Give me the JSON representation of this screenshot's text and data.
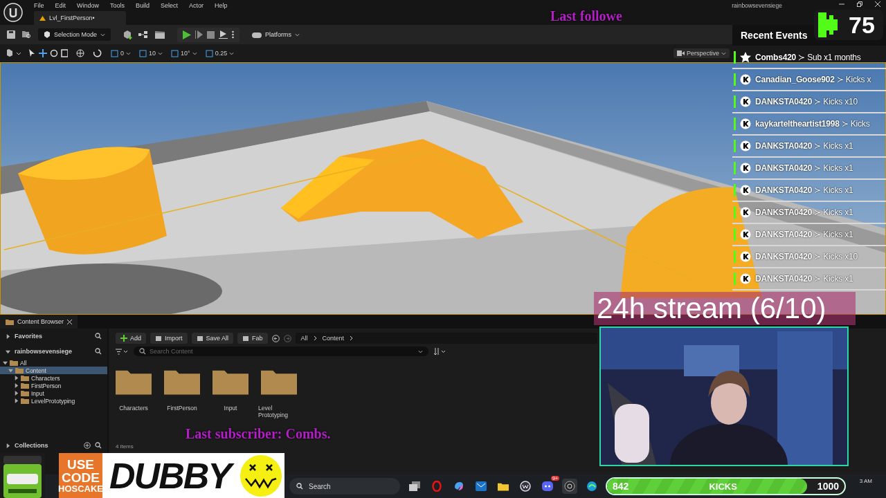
{
  "menu": [
    "File",
    "Edit",
    "Window",
    "Tools",
    "Build",
    "Select",
    "Actor",
    "Help"
  ],
  "account": "rainbowsevensiege",
  "level_tab": "Lvl_FirstPerson•",
  "toolbar": {
    "mode": "Selection Mode",
    "platforms": "Platforms"
  },
  "viewport_toolbar": {
    "snaps": [
      "0",
      "10",
      "10°",
      "0.25"
    ],
    "view": "Perspective"
  },
  "content_browser": {
    "tab": "Content Browser",
    "sections": [
      {
        "label": "Favorites",
        "expanded": false
      },
      {
        "label": "rainbowsevensiege",
        "expanded": true
      }
    ],
    "tree": [
      {
        "label": "All",
        "selected": false,
        "expanded": true,
        "children": [
          {
            "label": "Content",
            "selected": true,
            "expanded": true,
            "children": [
              {
                "label": "Characters",
                "selected": false,
                "expanded": false
              },
              {
                "label": "FirstPerson",
                "selected": false,
                "expanded": false
              },
              {
                "label": "Input",
                "selected": false,
                "expanded": false
              },
              {
                "label": "LevelPrototyping",
                "selected": false,
                "expanded": false
              }
            ]
          }
        ]
      }
    ],
    "collections": {
      "label": "Collections",
      "expanded": false
    },
    "buttons": [
      "Add",
      "Import",
      "Save All",
      "Fab"
    ],
    "breadcrumb": [
      "All",
      "Content"
    ],
    "search": {
      "placeholder": "Search Content"
    },
    "folders": [
      "Characters",
      "FirstPerson",
      "Input",
      "Level Prototyping"
    ],
    "item_count": "4 items"
  },
  "taskbar": {
    "search": "Search",
    "apps": [
      {
        "kind": "windows"
      },
      {
        "kind": "ring"
      },
      {
        "kind": "swirl"
      },
      {
        "kind": "mail"
      },
      {
        "kind": "folder"
      },
      {
        "kind": "w"
      },
      {
        "kind": "chat",
        "badge": "9+"
      },
      {
        "kind": "record",
        "active": true
      },
      {
        "kind": "browser"
      }
    ],
    "clock": "3 AM"
  },
  "overlay": {
    "last_follower": "Last followe",
    "kick_count": "75",
    "recent_events": {
      "title": "Recent Events",
      "items": [
        {
          "kind": "sub",
          "text": "**Combs420** ≻ Sub x1 months"
        },
        {
          "kind": "kick",
          "text": "**Canadian_Goose902** ≻ Kicks x"
        },
        {
          "kind": "kick",
          "text": "**DANKSTA0420** ≻ Kicks x10"
        },
        {
          "kind": "kick",
          "text": "**kaykarteltheartist1998** ≻ Kicks"
        },
        {
          "kind": "kick",
          "text": "**DANKSTA0420** ≻ Kicks x1"
        },
        {
          "kind": "kick",
          "text": "**DANKSTA0420** ≻ Kicks x1"
        },
        {
          "kind": "kick",
          "text": "**DANKSTA0420** ≻ Kicks x1"
        },
        {
          "kind": "kick",
          "text": "**DANKSTA0420** ≻ Kicks x1"
        },
        {
          "kind": "kick",
          "text": "**DANKSTA0420** ≻ Kicks x1"
        },
        {
          "kind": "kick",
          "text": "**DANKSTA0420** ≻ Kicks x10"
        },
        {
          "kind": "kick",
          "text": "**DANKSTA0420** ≻ Kicks x1"
        }
      ]
    },
    "stream_title": "24h stream (6/10)",
    "last_subscriber": "Last subscriber: Combs.",
    "kicks_goal": {
      "current": "842",
      "label": "KICKS",
      "goal": "1000",
      "level": 0.842
    },
    "ad": {
      "lines": [
        "USE",
        "CODE",
        "HOSCAKE"
      ],
      "brand": "DUBBY"
    }
  }
}
